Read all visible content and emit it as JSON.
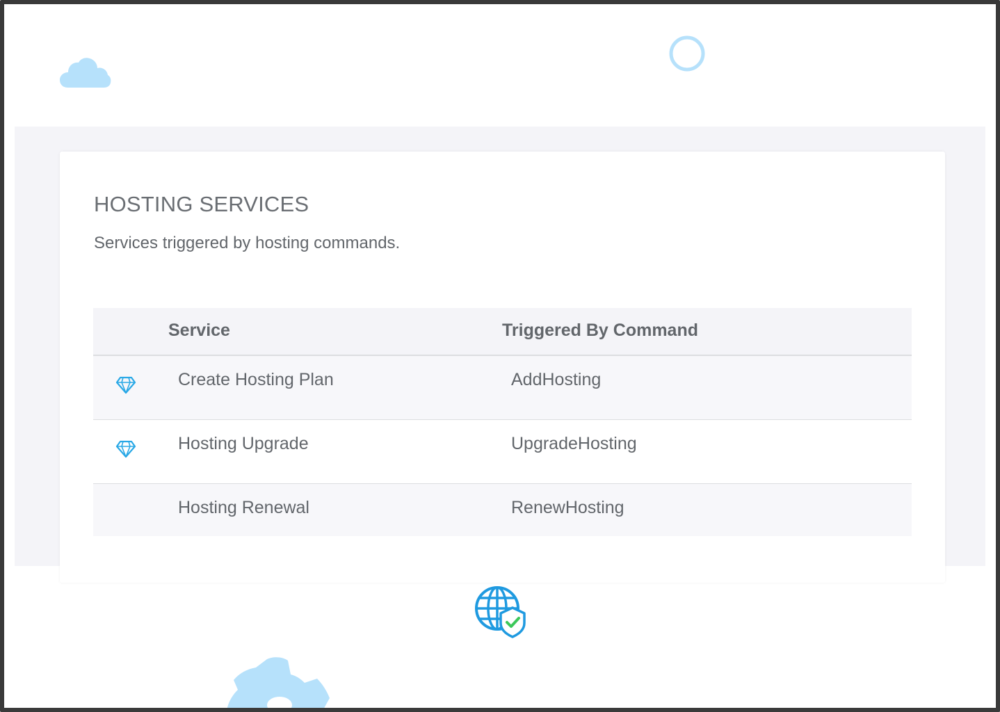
{
  "section": {
    "title": "HOSTING SERVICES",
    "subtitle": "Services triggered by hosting commands."
  },
  "table": {
    "columns": [
      "Service",
      "Triggered By Command"
    ],
    "rows": [
      {
        "service": "Create Hosting Plan",
        "command": "AddHosting",
        "icon": "diamond-icon"
      },
      {
        "service": "Hosting Upgrade",
        "command": "UpgradeHosting",
        "icon": "diamond-icon"
      },
      {
        "service": "Hosting Renewal",
        "command": "RenewHosting",
        "icon": ""
      }
    ]
  },
  "decorations": {
    "icons": [
      "cloud-icon",
      "ring-icon",
      "globe-shield-icon",
      "gear-icon"
    ]
  },
  "colors": {
    "accent": "#29a8e6",
    "decor_light": "#b6e1fb",
    "check_green": "#3cc85a",
    "band_bg": "#f4f4f8",
    "text": "#62666b"
  }
}
